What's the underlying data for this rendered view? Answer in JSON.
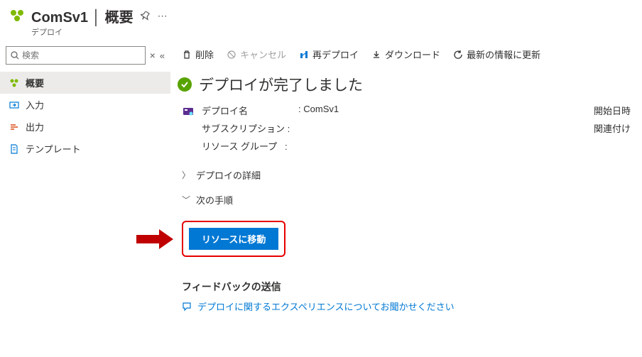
{
  "header": {
    "title": "ComSv1  │  概要",
    "subtitle": "デプロイ"
  },
  "search": {
    "placeholder": "検索"
  },
  "nav": {
    "overview": "概要",
    "inputs": "入力",
    "outputs": "出力",
    "template": "テンプレート"
  },
  "toolbar": {
    "delete": "削除",
    "cancel": "キャンセル",
    "redeploy": "再デプロイ",
    "download": "ダウンロード",
    "refresh": "最新の情報に更新"
  },
  "status": {
    "message": "デプロイが完了しました"
  },
  "details": {
    "deploy_name_label": "デプロイ名",
    "deploy_name_value": "ComSv1",
    "subscription_label": "サブスクリプション",
    "resource_group_label": "リソース グループ",
    "start_time_label": "開始日時",
    "correlation_label": "関連付け"
  },
  "sections": {
    "deploy_details": "デプロイの詳細",
    "next_steps": "次の手順"
  },
  "action": {
    "go_to_resource": "リソースに移動"
  },
  "feedback": {
    "title": "フィードバックの送信",
    "link": "デプロイに関するエクスペリエンスについてお聞かせください"
  },
  "separator": ":"
}
